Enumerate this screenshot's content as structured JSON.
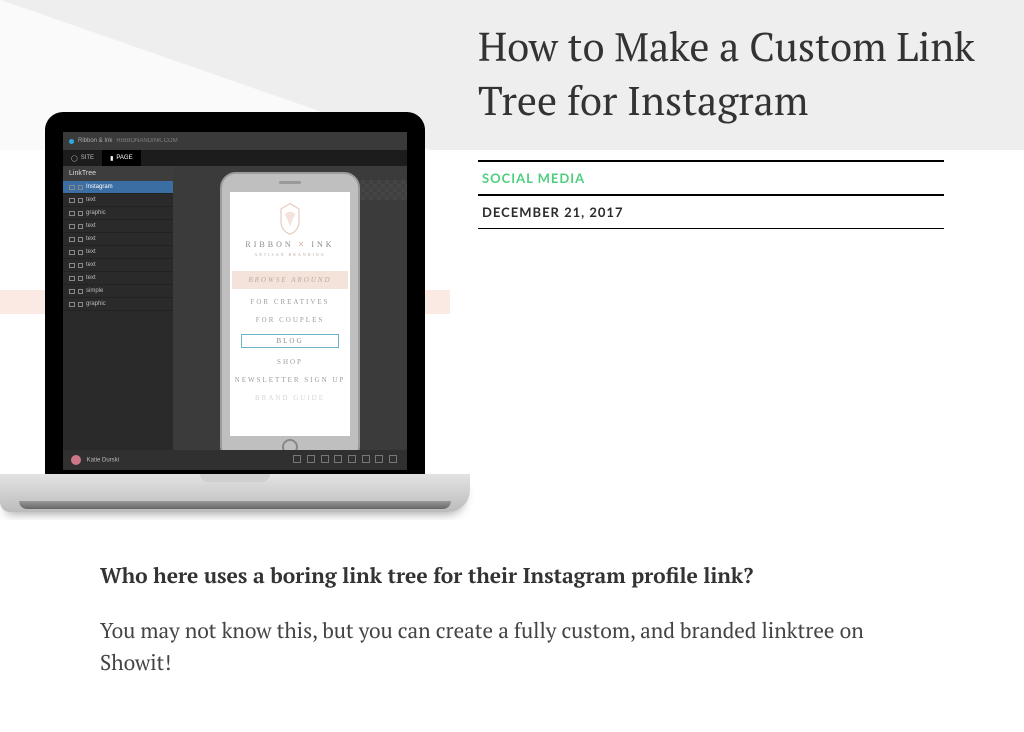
{
  "post": {
    "title": "How to Make a Custom Link Tree for Instagram",
    "category": "SOCIAL MEDIA",
    "date": "DECEMBER 21, 2017"
  },
  "article": {
    "lead": "Who here uses a boring link tree for their Instagram profile link?",
    "p1": "You may not know this, but you can create a fully custom, and branded linktree on Showit!"
  },
  "editor": {
    "app_name": "Ribbon & Ink",
    "app_domain": "RIBBONANDINK.COM",
    "tab_site": "SITE",
    "tab_page": "PAGE",
    "sidebar_title": "LinkTree",
    "layers": [
      {
        "label": "Instagram",
        "selected": true
      },
      {
        "label": "text"
      },
      {
        "label": "graphic"
      },
      {
        "label": "text"
      },
      {
        "label": "text"
      },
      {
        "label": "text"
      },
      {
        "label": "text"
      },
      {
        "label": "text"
      },
      {
        "label": "simple"
      },
      {
        "label": "graphic"
      }
    ],
    "user_name": "Katie Durski"
  },
  "phone": {
    "brand_top": "RIBBON",
    "brand_bottom": "INK",
    "brand_sub": "ARTISAN BRANDING",
    "browse": "BROWSE AROUND",
    "links": {
      "creatives": "FOR CREATIVES",
      "couples": "FOR COUPLES",
      "blog": "BLOG",
      "shop": "SHOP",
      "newsletter": "NEWSLETTER SIGN UP",
      "brand": "BRAND GUIDE"
    }
  }
}
